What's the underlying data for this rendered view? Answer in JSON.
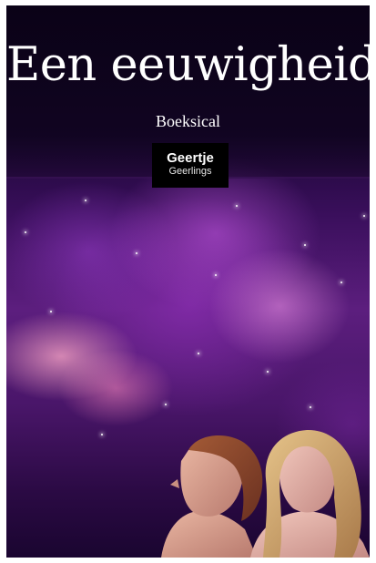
{
  "cover": {
    "title": "Een eeuwigheid",
    "subtitle": "Boeksical",
    "publisher_line1": "Geertje",
    "publisher_line2": "Geerlings",
    "illustration": "couple-looking-up-at-nebula",
    "colors": {
      "background": "#1a0633",
      "nebula": "#a040c8",
      "text": "#ffffff",
      "publisher_box": "#000000"
    }
  }
}
